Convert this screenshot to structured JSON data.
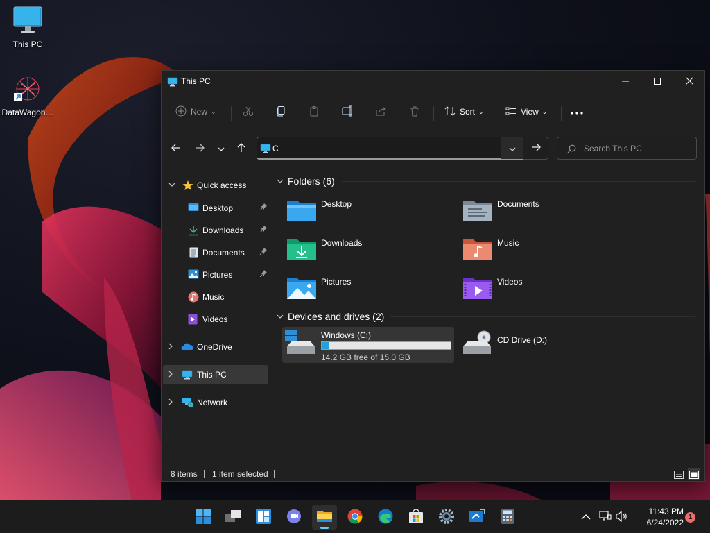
{
  "desktop": {
    "icons": [
      {
        "label": "This PC",
        "icon": "monitor-icon"
      },
      {
        "label": "DataWagon…",
        "icon": "datawagon-shortcut-icon"
      }
    ]
  },
  "window": {
    "title": "This PC",
    "controls": {
      "minimize": "minimize-icon",
      "maximize": "maximize-icon",
      "close": "close-icon"
    }
  },
  "commandbar": {
    "new_label": "New",
    "sort_label": "Sort",
    "view_label": "View",
    "actions": [
      "cut-icon",
      "copy-icon",
      "paste-icon",
      "rename-icon",
      "share-icon",
      "delete-icon",
      "more-icon"
    ]
  },
  "address": {
    "value": "C",
    "go_icon": "arrow-right-icon"
  },
  "search": {
    "placeholder": "Search This PC"
  },
  "sidebar": {
    "quick_access": "Quick access",
    "items": [
      {
        "label": "Desktop",
        "pinned": true
      },
      {
        "label": "Downloads",
        "pinned": true
      },
      {
        "label": "Documents",
        "pinned": true
      },
      {
        "label": "Pictures",
        "pinned": true
      },
      {
        "label": "Music",
        "pinned": false
      },
      {
        "label": "Videos",
        "pinned": false
      }
    ],
    "onedrive": "OneDrive",
    "this_pc": "This PC",
    "network": "Network"
  },
  "content": {
    "folders_header": "Folders (6)",
    "folders": [
      {
        "label": "Desktop"
      },
      {
        "label": "Documents"
      },
      {
        "label": "Downloads"
      },
      {
        "label": "Music"
      },
      {
        "label": "Pictures"
      },
      {
        "label": "Videos"
      }
    ],
    "devices_header": "Devices and drives (2)",
    "drives": [
      {
        "label": "Windows (C:)",
        "free_text": "14.2 GB free of 15.0 GB",
        "used_fraction": 0.053
      },
      {
        "label": "CD Drive (D:)"
      }
    ]
  },
  "statusbar": {
    "items_count": "8 items",
    "selection": "1 item selected"
  },
  "taskbar": {
    "apps": [
      "start-icon",
      "task-view-icon",
      "widgets-icon",
      "teams-chat-icon",
      "file-explorer-icon",
      "chrome-icon",
      "edge-icon",
      "store-icon",
      "settings-icon",
      "remote-desktop-icon",
      "calculator-icon"
    ],
    "time": "11:43 PM",
    "date": "6/24/2022",
    "notification_count": "1"
  },
  "colors": {
    "accent": "#60cdff",
    "window_bg": "#202020",
    "drive_bar_fill": "#26a0da",
    "taskbar_bg": "#1c1c1c"
  }
}
